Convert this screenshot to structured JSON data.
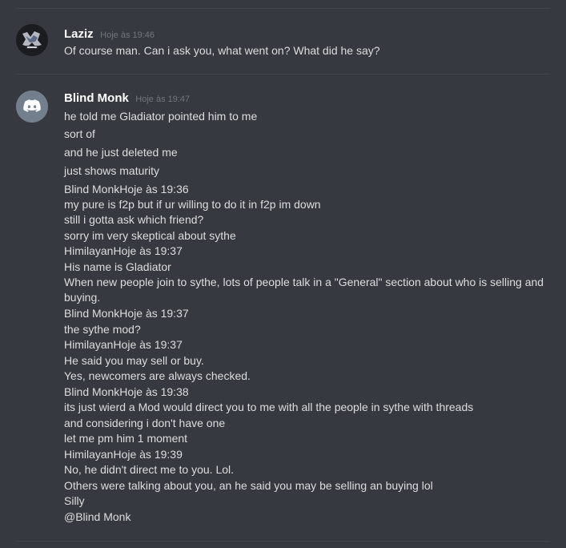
{
  "messages": [
    {
      "author": "Laziz",
      "timestamp": "Hoje às 19:46",
      "lines": [
        "Of course man. Can i ask you, what went on? What did he say?"
      ]
    },
    {
      "author": "Blind Monk",
      "timestamp": "Hoje às 19:47",
      "lines": [
        "he told me Gladiator pointed him to me",
        "sort of",
        "and he just deleted me",
        "just shows maturity",
        "Blind MonkHoje às 19:36",
        "my pure is f2p but if ur willing to do it in f2p im down",
        "still i gotta ask which friend?",
        "sorry im very skeptical about sythe",
        "HimilayanHoje às 19:37",
        "His name is Gladiator",
        "When new people join to sythe, lots of people talk in a \"General\" section about who is selling and buying.",
        "Blind MonkHoje às 19:37",
        "the sythe mod?",
        "HimilayanHoje às 19:37",
        "He said you may sell or buy.",
        "Yes, newcomers are always checked.",
        "Blind MonkHoje às 19:38",
        "its just wierd a Mod would direct you to me with all the people in sythe with threads",
        "and considering i don't have one",
        "let me pm him 1 moment",
        "HimilayanHoje às 19:39",
        "No, he didn't direct me to you. Lol.",
        "Others were talking about you, an he said you may be selling an buying lol",
        "Silly",
        "@Blind Monk"
      ]
    }
  ],
  "colors": {
    "background": "#36393f",
    "author": "#ffffff",
    "timestamp": "#72767d",
    "text": "#dcddde",
    "discord_avatar": "#747f8d"
  },
  "icons": {
    "laziz_avatar": "laziz-logo-avatar",
    "blind_monk_avatar": "discord-logo-icon"
  }
}
